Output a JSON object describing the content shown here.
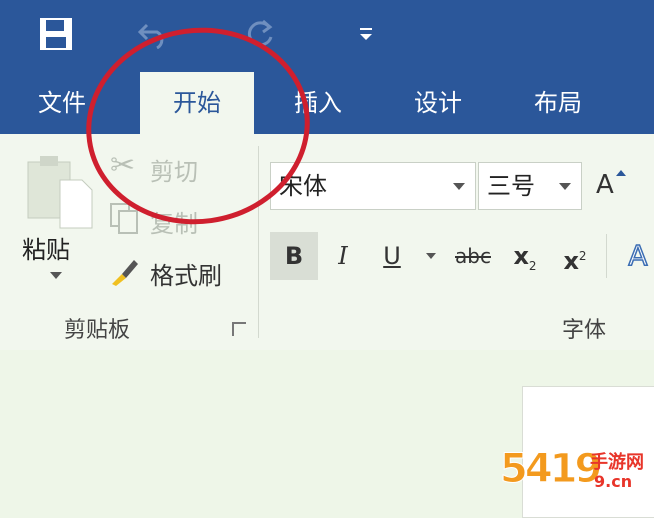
{
  "quick_access": {
    "save_icon": "floppy-disk-icon",
    "undo_icon": "undo-icon",
    "redo_icon": "redo-icon",
    "customize_icon": "customize-qat-icon"
  },
  "tabs": [
    {
      "label": "文件"
    },
    {
      "label": "开始",
      "active": true
    },
    {
      "label": "插入"
    },
    {
      "label": "设计"
    },
    {
      "label": "布局"
    }
  ],
  "clipboard": {
    "paste_label": "粘贴",
    "cut_label": "剪切",
    "copy_label": "复制",
    "format_painter_label": "格式刷",
    "group_label": "剪贴板"
  },
  "font": {
    "font_name": "宋体",
    "font_size": "三号",
    "bold": "B",
    "italic": "I",
    "underline": "U",
    "strikethrough": "abc",
    "subscript_base": "x",
    "subscript_mark": "2",
    "superscript_base": "x",
    "superscript_mark": "2",
    "grow_font": "A",
    "text_effects": "A",
    "group_label": "字体"
  },
  "watermark": {
    "digits": "5419",
    "text": "手游网",
    "domain": "9.cn"
  },
  "colors": {
    "accent": "#2b579a",
    "ribbon": "#f2f7ee",
    "annotation": "#cf1f2e"
  }
}
